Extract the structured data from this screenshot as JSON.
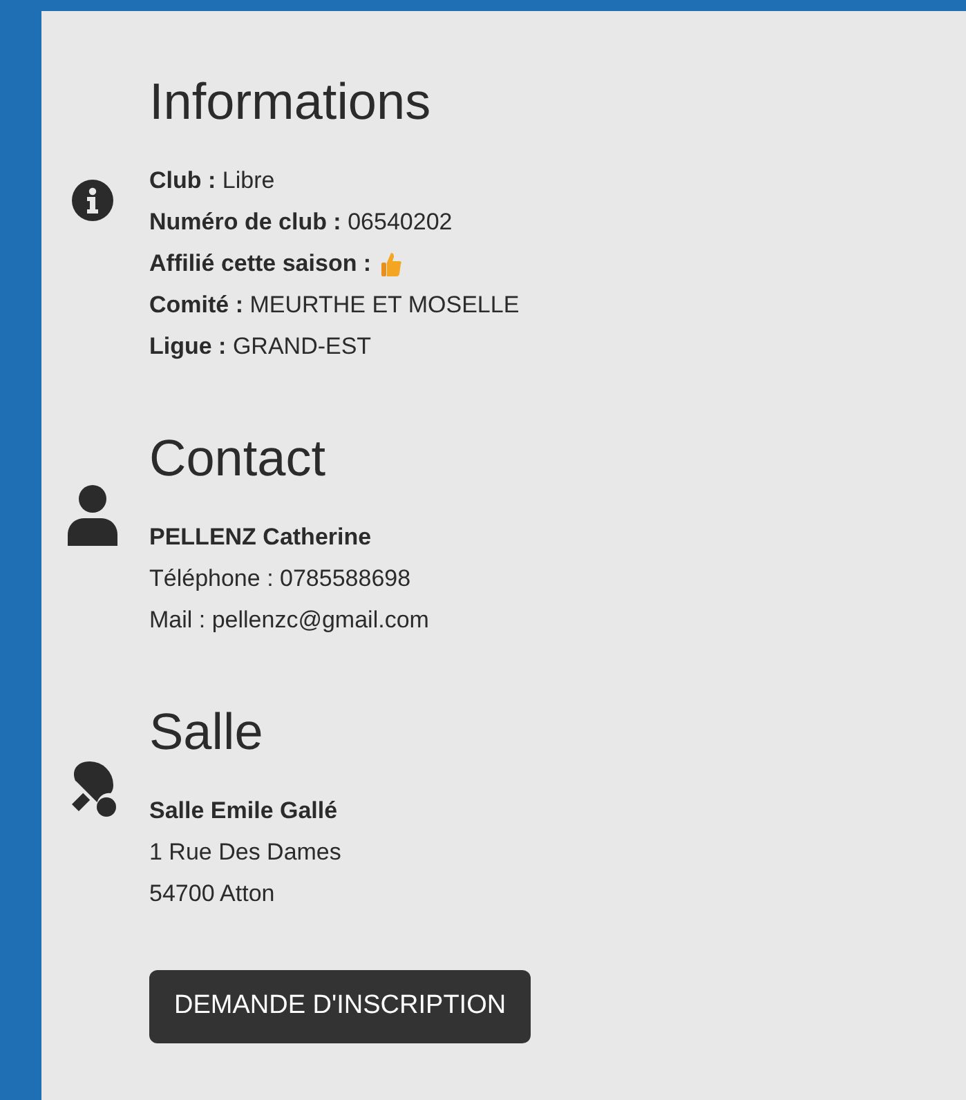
{
  "sections": [
    {
      "title": "Informations",
      "kind": "info",
      "lines": [
        {
          "kind": "field",
          "label": "Club :",
          "value": "Libre"
        },
        {
          "kind": "field",
          "label": "Numéro de club :",
          "value": "06540202"
        },
        {
          "kind": "flag",
          "label": "Affilié cette saison :",
          "on": true
        },
        {
          "kind": "field",
          "label": "Comité :",
          "value": "MEURTHE ET MOSELLE"
        },
        {
          "kind": "field",
          "label": "Ligue :",
          "value": "GRAND-EST"
        }
      ]
    },
    {
      "title": "Contact",
      "kind": "contact",
      "lines": [
        {
          "kind": "name",
          "value": "PELLENZ Catherine"
        },
        {
          "kind": "text",
          "value": "Téléphone : 0785588698"
        },
        {
          "kind": "text",
          "value": "Mail : pellenzc@gmail.com"
        }
      ]
    },
    {
      "title": "Salle",
      "kind": "venue",
      "lines": [
        {
          "kind": "name",
          "value": "Salle Emile Gallé"
        },
        {
          "kind": "text",
          "value": "1 Rue Des Dames"
        },
        {
          "kind": "text",
          "value": "54700 Atton"
        }
      ]
    }
  ],
  "button": "DEMANDE D'INSCRIPTION"
}
